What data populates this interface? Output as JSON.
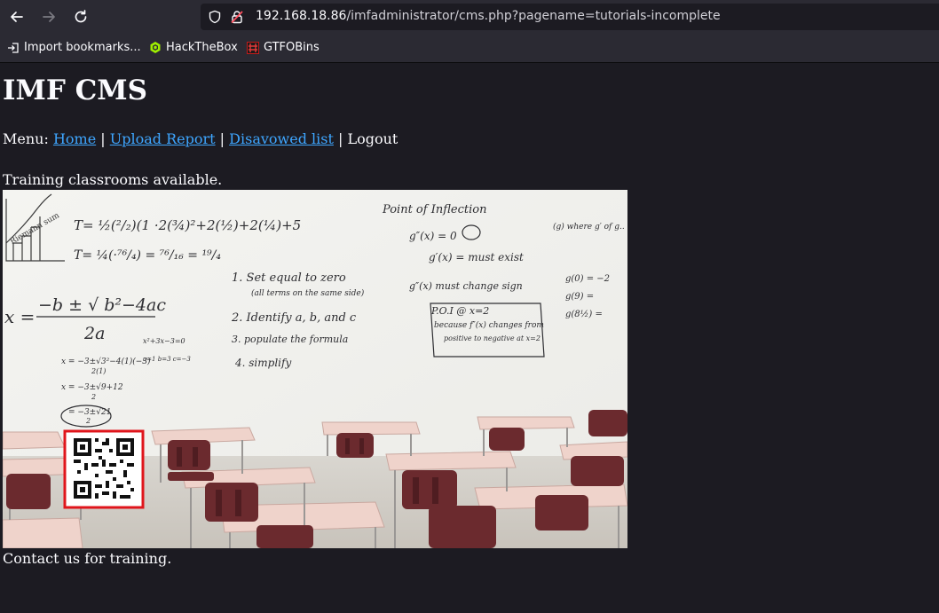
{
  "browser": {
    "url_host": "192.168.18.86",
    "url_path": "/imfadministrator/cms.php?pagename=tutorials-incomplete",
    "bookmarks": [
      {
        "label": "Import bookmarks..."
      },
      {
        "label": "HackTheBox"
      },
      {
        "label": "GTFOBins"
      }
    ]
  },
  "page": {
    "title": "IMF CMS",
    "menu_prefix": "Menu:",
    "menu_links": [
      "Home",
      "Upload Report",
      "Disavowed list"
    ],
    "menu_separator": "|",
    "menu_logout": "Logout",
    "intro": "Training classrooms available.",
    "contact": "Contact us for training."
  },
  "whiteboard": {
    "line1": "T= ½(²/₂)(1 ·2(¾)²+2(½)+2(¼)+5",
    "line2": "T= ¼(·⁷⁶/₄) = ⁷⁶/₁₆ = ¹⁹/₄",
    "heading": "Point of Inflection",
    "step1": "1. Set equal to zero",
    "step1b": "(all terms on the same side)",
    "step2": "2. Identify a, b, and c",
    "step3": "3. populate the formula",
    "step4": "4. simplify",
    "quadratic_lhs": "x =",
    "quadratic_num": "−b ± √ b²−4ac",
    "quadratic_den": "2a",
    "deriv1": "g″(x) = 0",
    "deriv2": "g′(x) = must exist",
    "deriv3": "g″(x) must change sign",
    "poi": "P.O.I @ x=2",
    "poi2": "because f″(x) changes from",
    "poi3": "positive to negative at x=2",
    "right1": "(g) where g′ of g..",
    "right2": "g(0) = −2",
    "right3": "g(9) =",
    "right4": "g(8½) =",
    "side_eq": "x²+3x−3=0",
    "side_abc": "a=1  b=3  c=−3",
    "work1": "x = −3±√3²−4(1)(−3)",
    "work1_den": "2(1)",
    "work2": "x = −3±√9+12",
    "work2_den": "2",
    "work3": "= −3±√21",
    "work3_den": "2",
    "graph_label": "Riemann sum"
  }
}
